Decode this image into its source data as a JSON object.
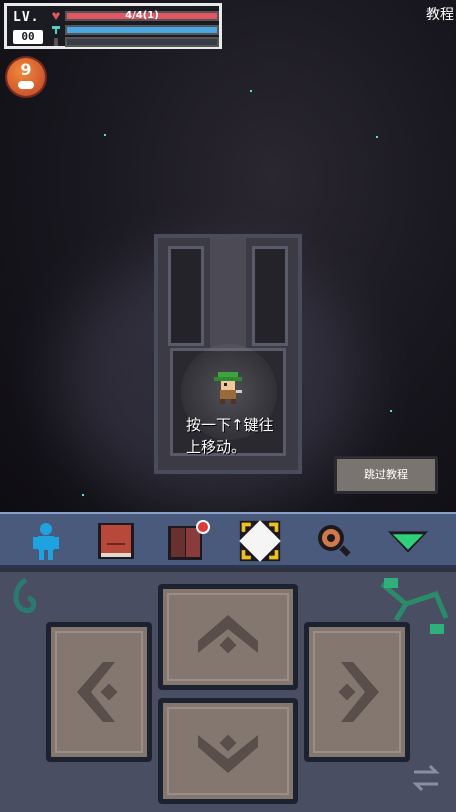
{
  "hud": {
    "level_label": "LV.",
    "level_value": "00",
    "hp_text": "4/4(1)",
    "hp_fraction": 1.0,
    "armor_fraction": 1.0,
    "energy_fraction": 0.0
  },
  "screen_title": "教程",
  "coin_count": "9",
  "tutorial_hint": "按一下↑键往上移动。",
  "skip_button_label": "跳过教程",
  "toolbar": {
    "items": [
      {
        "icon": "character-icon"
      },
      {
        "icon": "book-icon"
      },
      {
        "icon": "notebook-alert-icon"
      },
      {
        "icon": "target-highlight-icon"
      },
      {
        "icon": "magnifier-icon"
      },
      {
        "icon": "collapse-arrow-icon"
      }
    ]
  },
  "dpad": {
    "up": "up-arrow-icon",
    "down": "down-arrow-icon",
    "left": "left-arrow-icon",
    "right": "right-arrow-icon"
  },
  "colors": {
    "hp": "#e25563",
    "armor": "#4aa6e0",
    "toolbar": "#4a5a7c",
    "panel": "#4a4e62",
    "key": "#837770"
  }
}
